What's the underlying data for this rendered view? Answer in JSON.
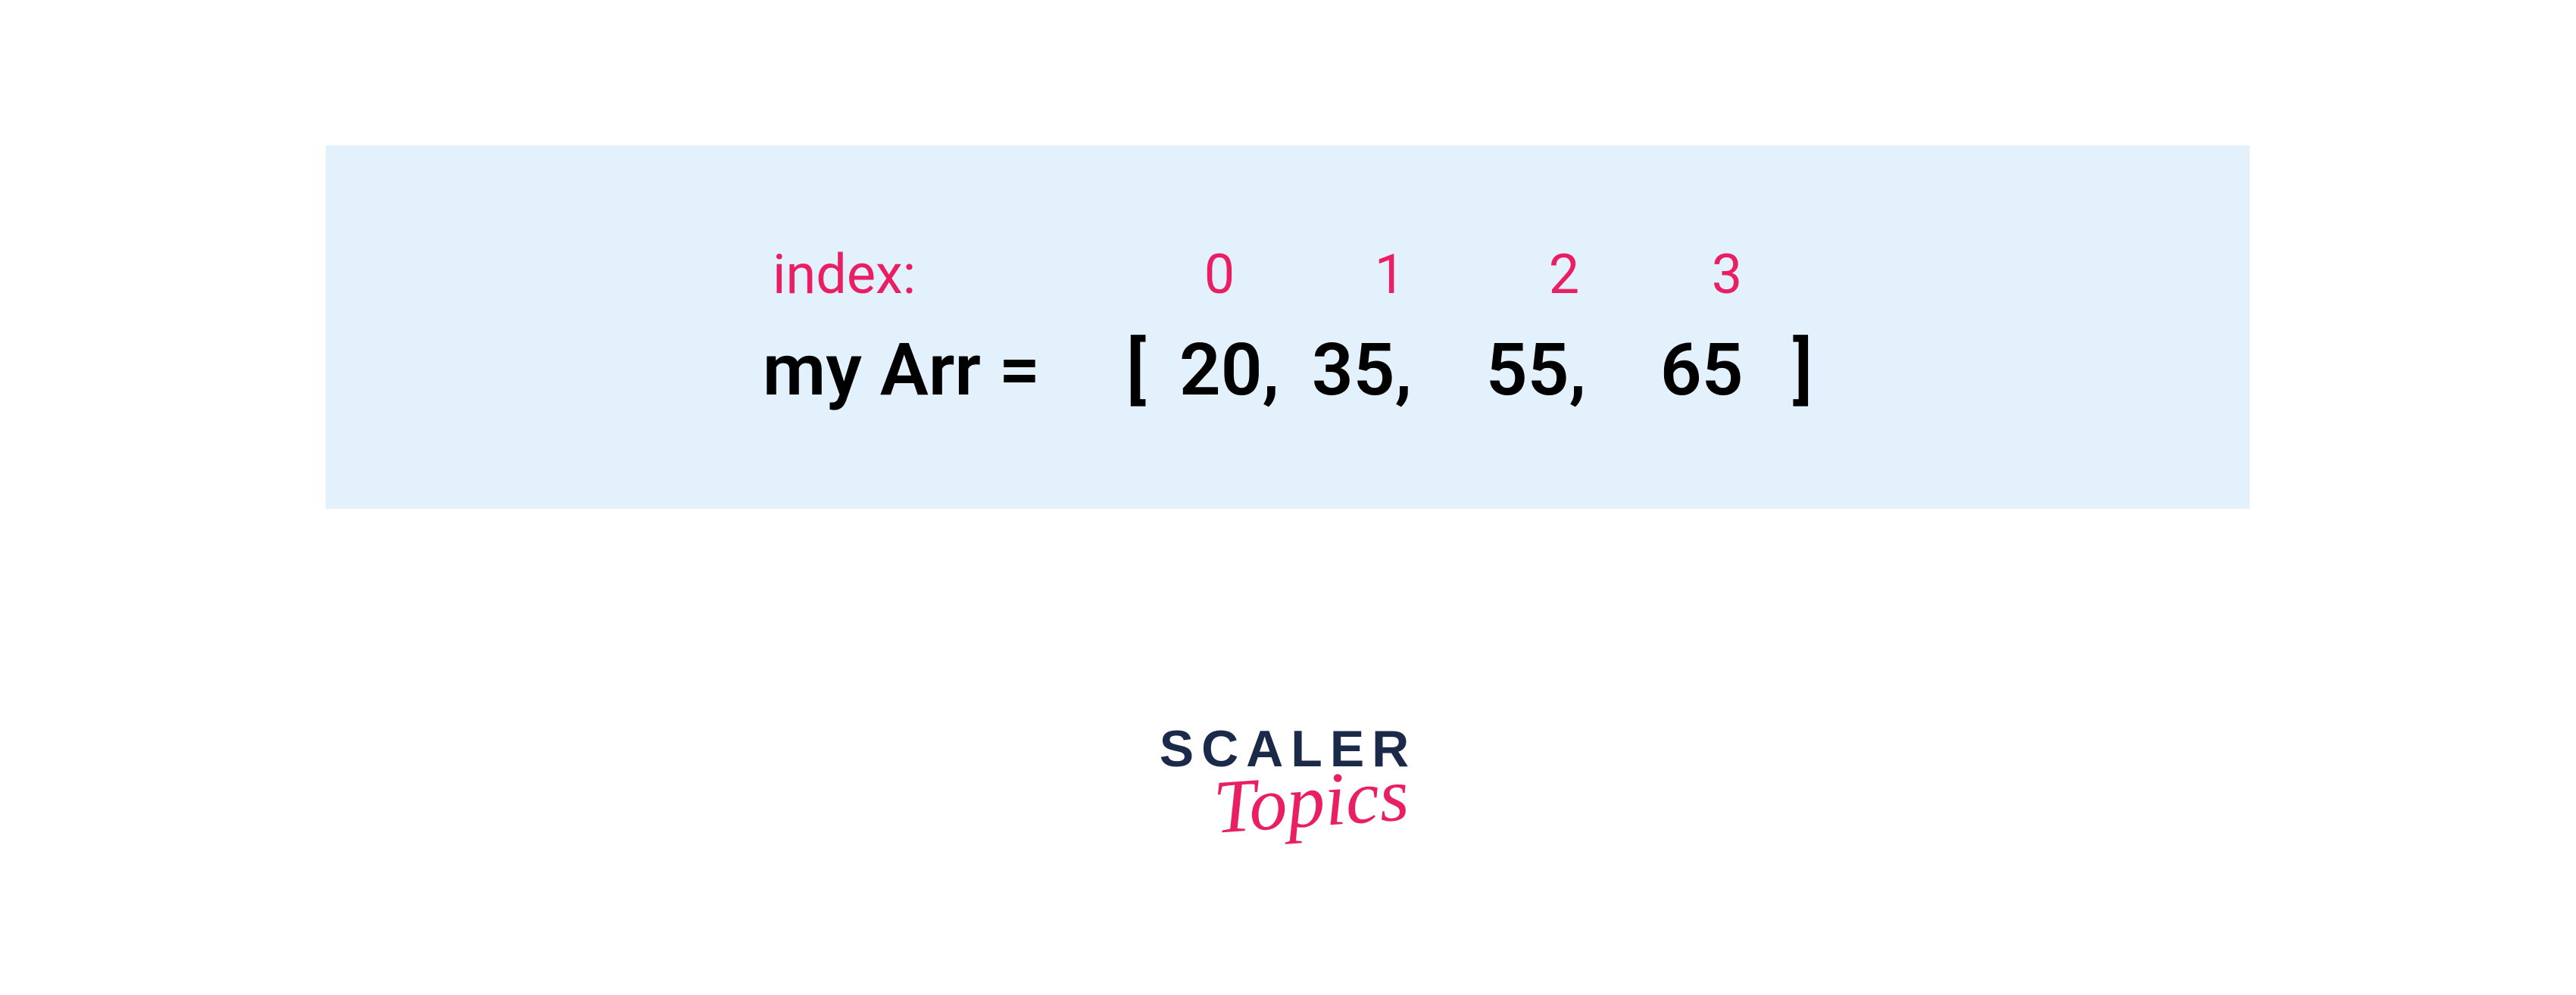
{
  "diagram": {
    "index_label": "index:",
    "indices": [
      "0",
      "1",
      "2",
      "3"
    ],
    "array_name": "my Arr = ",
    "bracket_open": "[ ",
    "values": [
      "20,",
      " 35,",
      " 55,",
      " 65"
    ],
    "bracket_close": "]"
  },
  "logo": {
    "line1": "SCALER",
    "line2": "Topics"
  },
  "colors": {
    "accent": "#e91e63",
    "box_bg": "#e3f1fd",
    "logo_dark": "#1c2a4a"
  }
}
